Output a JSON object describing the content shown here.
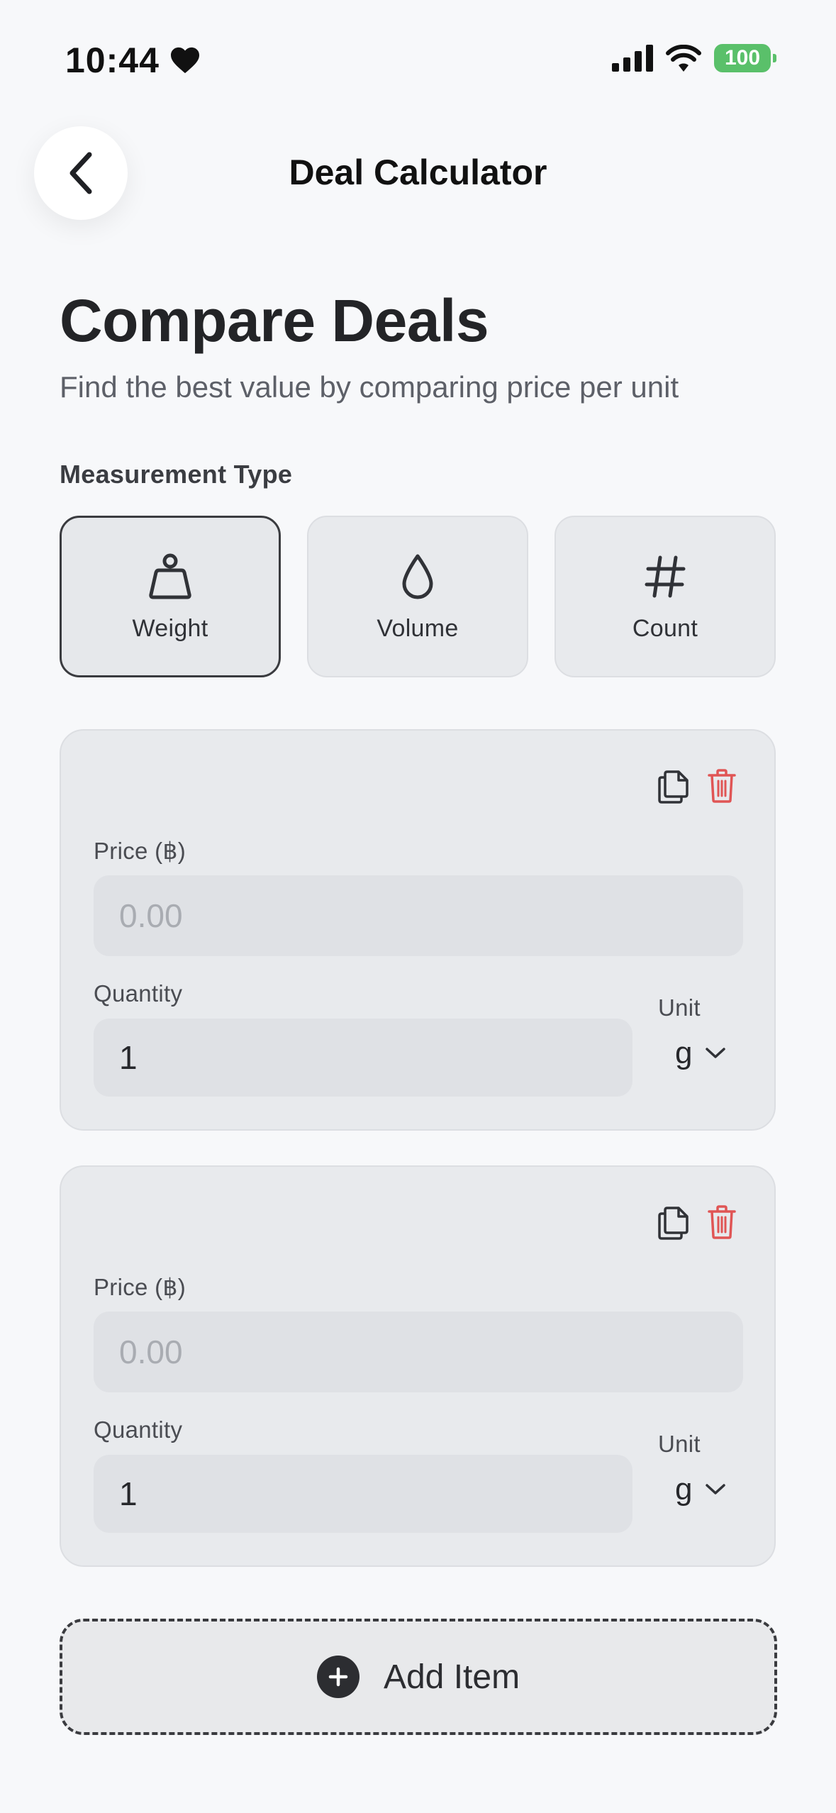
{
  "status_bar": {
    "time": "10:44",
    "battery": "100",
    "battery_color": "#5ac06a"
  },
  "header": {
    "title": "Deal Calculator",
    "back_icon": "chevron-left-icon"
  },
  "page": {
    "title": "Compare Deals",
    "subtitle": "Find the best value by comparing price per unit"
  },
  "measurement": {
    "label": "Measurement Type",
    "options": [
      {
        "label": "Weight",
        "icon": "weight-icon",
        "selected": true
      },
      {
        "label": "Volume",
        "icon": "droplet-icon",
        "selected": false
      },
      {
        "label": "Count",
        "icon": "hash-icon",
        "selected": false
      }
    ]
  },
  "items": [
    {
      "price_label": "Price (฿)",
      "price_placeholder": "0.00",
      "price_value": "",
      "quantity_label": "Quantity",
      "quantity_value": "1",
      "unit_label": "Unit",
      "unit_value": "g"
    },
    {
      "price_label": "Price (฿)",
      "price_placeholder": "0.00",
      "price_value": "",
      "quantity_label": "Quantity",
      "quantity_value": "1",
      "unit_label": "Unit",
      "unit_value": "g"
    }
  ],
  "add_item": {
    "label": "Add Item"
  },
  "colors": {
    "background": "#f7f8fa",
    "card": "#e8eaed",
    "input": "#dfe1e5",
    "delete": "#e05555",
    "text": "#26272b"
  }
}
